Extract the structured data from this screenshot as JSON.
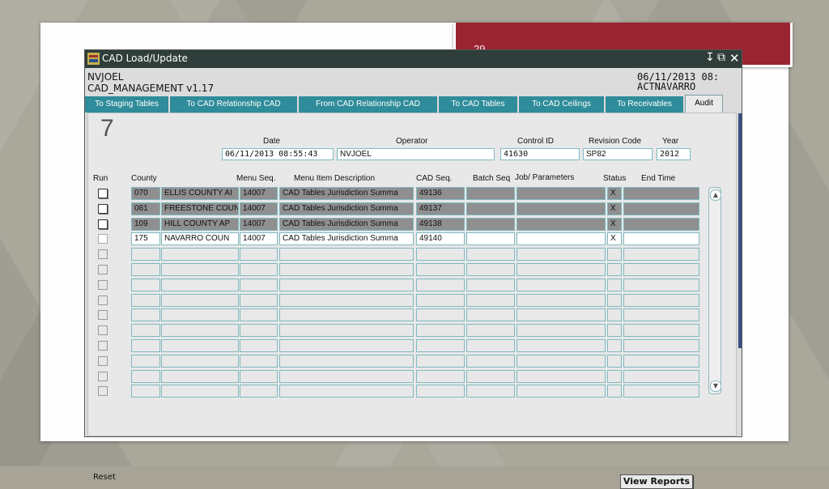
{
  "slide": {
    "number": "29"
  },
  "window": {
    "title": "CAD Load/Update",
    "user": "NVJOEL",
    "module": "CAD_MANAGEMENT v1.17",
    "datetime": "06/11/2013 08:",
    "subtitle": "ACTNAVARRO"
  },
  "tabs": [
    {
      "label": "To Staging Tables"
    },
    {
      "label": "To CAD Relationship CAD"
    },
    {
      "label": "From CAD Relationship CAD"
    },
    {
      "label": "To CAD Tables"
    },
    {
      "label": "To CAD Ceilings"
    },
    {
      "label": "To Receivables"
    },
    {
      "label": "Audit"
    }
  ],
  "audit": {
    "count": "7",
    "labels": {
      "date": "Date",
      "operator": "Operator",
      "control_id": "Control ID",
      "revision_code": "Revision Code",
      "year": "Year"
    },
    "values": {
      "date": "06/11/2013 08:55:43",
      "operator": "NVJOEL",
      "control_id": "41630",
      "revision_code": "SP82",
      "year": "2012"
    }
  },
  "columns": {
    "run": "Run",
    "county": "County",
    "menu_seq": "Menu Seq.",
    "menu_desc": "Menu Item Description",
    "cad_seq": "CAD Seq.",
    "batch_seq": "Batch Seq",
    "job": "Job/ Parameters",
    "status": "Status",
    "end_time": "End Time"
  },
  "rows": [
    {
      "code": "070",
      "county": "ELLIS COUNTY AI",
      "menu_seq": "14007",
      "desc": "CAD Tables Jurisdiction Summa",
      "cad_seq": "49136",
      "batch": "",
      "job": "",
      "status": "X",
      "end": "",
      "style": "dark"
    },
    {
      "code": "081",
      "county": "FREESTONE COUN",
      "menu_seq": "14007",
      "desc": "CAD Tables Jurisdiction Summa",
      "cad_seq": "49137",
      "batch": "",
      "job": "",
      "status": "X",
      "end": "",
      "style": "dark"
    },
    {
      "code": "109",
      "county": "HILL COUNTY AP",
      "menu_seq": "14007",
      "desc": "CAD Tables Jurisdiction Summa",
      "cad_seq": "49138",
      "batch": "",
      "job": "",
      "status": "X",
      "end": "",
      "style": "dark"
    },
    {
      "code": "175",
      "county": "NAVARRO COUN",
      "menu_seq": "14007",
      "desc": "CAD Tables Jurisdiction Summa",
      "cad_seq": "49140",
      "batch": "",
      "job": "",
      "status": "X",
      "end": "",
      "style": "white"
    }
  ],
  "empty_rows": 10,
  "buttons": {
    "reset": "Reset",
    "view_reports": "View Reports"
  }
}
